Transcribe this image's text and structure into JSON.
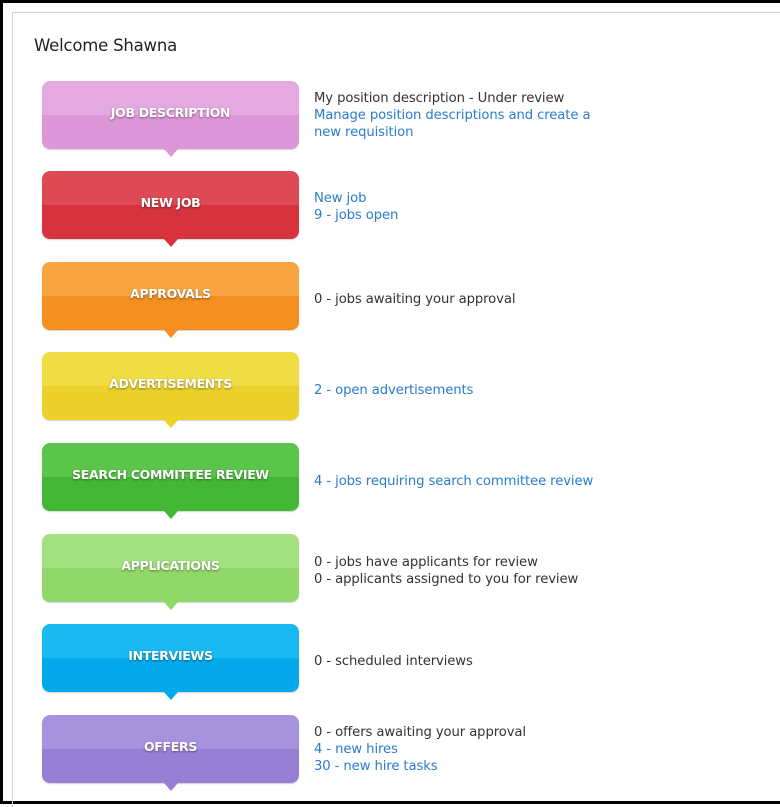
{
  "welcome": "Welcome Shawna",
  "tiles": [
    {
      "label": "JOB DESCRIPTION",
      "colors": {
        "top": "#e5a9e1",
        "bottom": "#dd96d8"
      },
      "lines": [
        {
          "text": "My position description - Under review",
          "link": false
        },
        {
          "text": "Manage position descriptions and create a",
          "link": true
        },
        {
          "text": "new requisition",
          "link": true
        }
      ]
    },
    {
      "label": "NEW JOB",
      "colors": {
        "top": "#dd4a55",
        "bottom": "#d7333f"
      },
      "lines": [
        {
          "text": "New job",
          "link": true
        },
        {
          "text": "9 - jobs open",
          "link": true
        }
      ]
    },
    {
      "label": "APPROVALS",
      "colors": {
        "top": "#f8a541",
        "bottom": "#f58f1f"
      },
      "lines": [
        {
          "text": "0 - jobs awaiting your approval",
          "link": false
        }
      ]
    },
    {
      "label": "ADVERTISEMENTS",
      "colors": {
        "top": "#f0dc44",
        "bottom": "#ebd12a"
      },
      "lines": [
        {
          "text": "2 - open advertisements",
          "link": true
        }
      ]
    },
    {
      "label": "SEARCH COMMITTEE REVIEW",
      "colors": {
        "top": "#5ac54a",
        "bottom": "#45b736"
      },
      "lines": [
        {
          "text": "4 - jobs requiring search committee review",
          "link": true
        }
      ]
    },
    {
      "label": "APPLICATIONS",
      "colors": {
        "top": "#a3e080",
        "bottom": "#91d86a"
      },
      "lines": [
        {
          "text": "0 - jobs have applicants for review",
          "link": false
        },
        {
          "text": "0 - applicants assigned to you for review",
          "link": false
        }
      ]
    },
    {
      "label": "INTERVIEWS",
      "colors": {
        "top": "#1bb9f2",
        "bottom": "#03a9ea"
      },
      "lines": [
        {
          "text": "0 - scheduled interviews",
          "link": false
        }
      ]
    },
    {
      "label": "OFFERS",
      "colors": {
        "top": "#a793dd",
        "bottom": "#987fd5"
      },
      "lines": [
        {
          "text": "0 - offers awaiting your approval",
          "link": false
        },
        {
          "text": "4 - new hires",
          "link": true
        },
        {
          "text": "30 - new hire tasks",
          "link": true
        }
      ]
    }
  ]
}
